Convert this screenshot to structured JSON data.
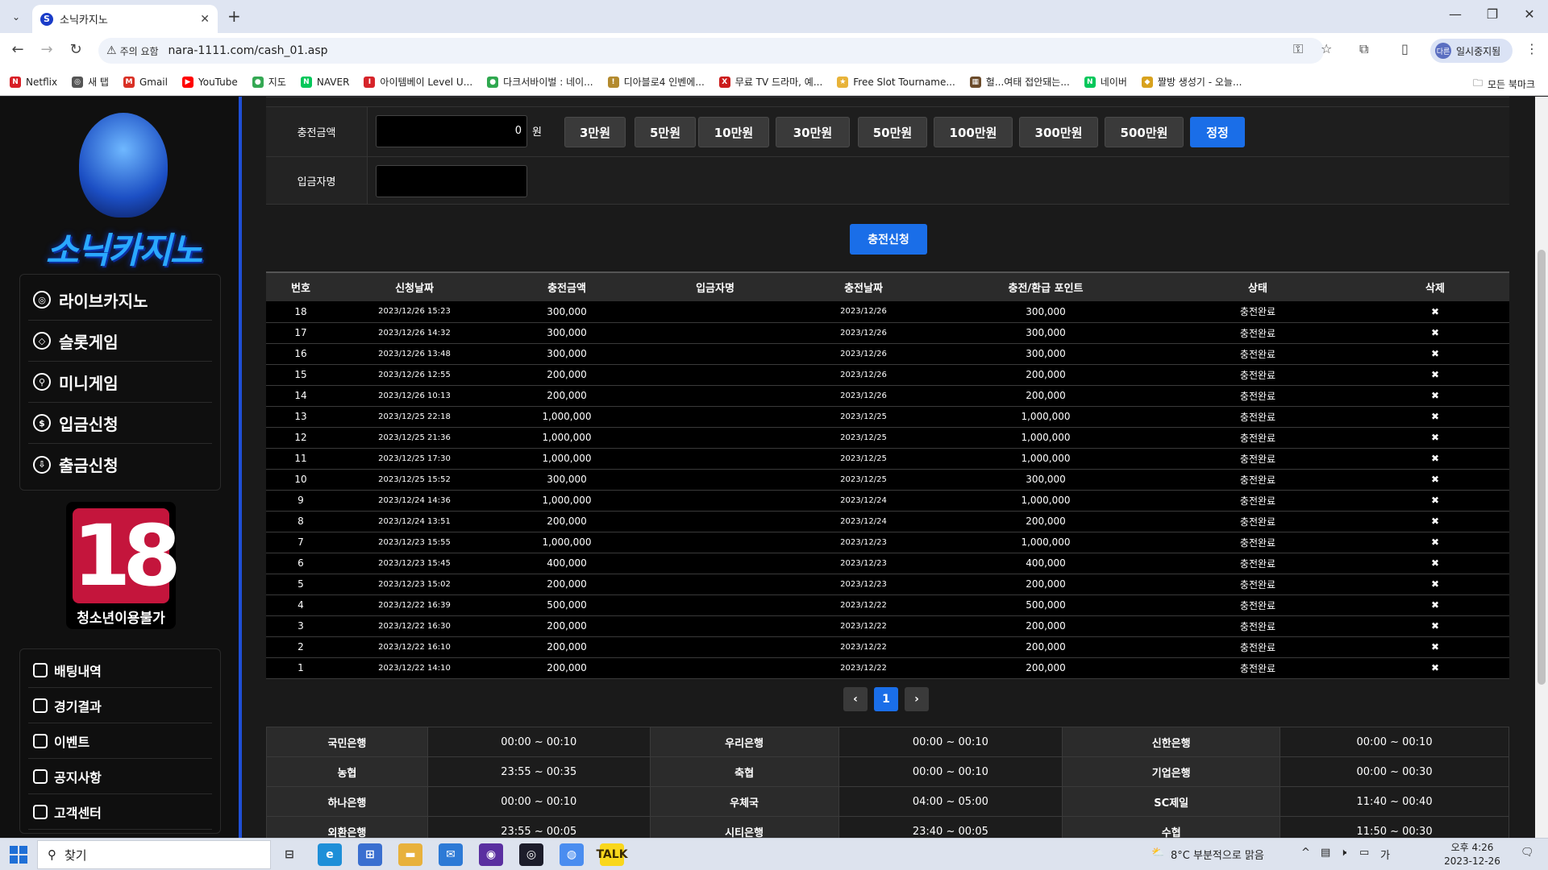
{
  "browser": {
    "tab_title": "소닉카지노",
    "tab_favicon": "S",
    "url": "nara-1111.com/cash_01.asp",
    "security_chip": "주의 요함",
    "profile_label": "일시중지됨",
    "profile_avatar": "다른"
  },
  "bookmarks": [
    {
      "label": "Netflix",
      "icon": "N",
      "color": "#d81f26"
    },
    {
      "label": "새 탭",
      "icon": "◎",
      "color": "#555555"
    },
    {
      "label": "Gmail",
      "icon": "M",
      "color": "#d93025"
    },
    {
      "label": "YouTube",
      "icon": "▶",
      "color": "#ff0000"
    },
    {
      "label": "지도",
      "icon": "●",
      "color": "#34a853"
    },
    {
      "label": "NAVER",
      "icon": "N",
      "color": "#03c75a"
    },
    {
      "label": "아이템베이 Level U...",
      "icon": "I",
      "color": "#d6242a"
    },
    {
      "label": "다크서바이벌 : 네이...",
      "icon": "●",
      "color": "#2fa84f"
    },
    {
      "label": "디아블로4 인벤에...",
      "icon": "!",
      "color": "#b38a2e"
    },
    {
      "label": "무료 TV 드라마, 예...",
      "icon": "X",
      "color": "#cc1c1c"
    },
    {
      "label": "Free Slot Tourname...",
      "icon": "★",
      "color": "#e8b339"
    },
    {
      "label": "헐...여태 접안돼는...",
      "icon": "▦",
      "color": "#6b4b2a"
    },
    {
      "label": "네이버",
      "icon": "N",
      "color": "#03c75a"
    },
    {
      "label": "짤방 생성기 - 오늘...",
      "icon": "◆",
      "color": "#d8a21e"
    }
  ],
  "bookmarks_all": "모든 북마크",
  "sidebar": {
    "brand": "소닉카지노",
    "main_menu": [
      {
        "label": "라이브카지노",
        "icon": "chip-icon"
      },
      {
        "label": "슬롯게임",
        "icon": "diamond-icon"
      },
      {
        "label": "미니게임",
        "icon": "joystick-icon"
      },
      {
        "label": "입금신청",
        "icon": "dollar-icon"
      },
      {
        "label": "출금신청",
        "icon": "download-icon"
      }
    ],
    "age_number": "18",
    "age_text": "청소년이용불가",
    "sub_menu": [
      {
        "label": "배팅내역",
        "icon": "list-icon"
      },
      {
        "label": "경기결과",
        "icon": "trophy-icon"
      },
      {
        "label": "이벤트",
        "icon": "gift-icon"
      },
      {
        "label": "공지사항",
        "icon": "megaphone-icon"
      },
      {
        "label": "고객센터",
        "icon": "headset-icon"
      }
    ]
  },
  "form": {
    "amount_label": "충전금액",
    "amount_value": "0",
    "amount_unit": "원",
    "amount_buttons": [
      "3만원",
      "5만원",
      "10만원",
      "30만원",
      "50만원",
      "100만원",
      "300만원",
      "500만원"
    ],
    "correct_button": "정정",
    "depositor_label": "입금자명",
    "submit_button": "충전신청"
  },
  "history": {
    "headers": [
      "번호",
      "신청날짜",
      "충전금액",
      "입금자명",
      "충전날짜",
      "충전/환급 포인트",
      "상태",
      "삭제"
    ],
    "rows": [
      [
        "18",
        "2023/12/26 15:23",
        "300,000",
        "",
        "2023/12/26",
        "300,000",
        "충전완료",
        "✖"
      ],
      [
        "17",
        "2023/12/26 14:32",
        "300,000",
        "",
        "2023/12/26",
        "300,000",
        "충전완료",
        "✖"
      ],
      [
        "16",
        "2023/12/26 13:48",
        "300,000",
        "",
        "2023/12/26",
        "300,000",
        "충전완료",
        "✖"
      ],
      [
        "15",
        "2023/12/26 12:55",
        "200,000",
        "",
        "2023/12/26",
        "200,000",
        "충전완료",
        "✖"
      ],
      [
        "14",
        "2023/12/26 10:13",
        "200,000",
        "",
        "2023/12/26",
        "200,000",
        "충전완료",
        "✖"
      ],
      [
        "13",
        "2023/12/25 22:18",
        "1,000,000",
        "",
        "2023/12/25",
        "1,000,000",
        "충전완료",
        "✖"
      ],
      [
        "12",
        "2023/12/25 21:36",
        "1,000,000",
        "",
        "2023/12/25",
        "1,000,000",
        "충전완료",
        "✖"
      ],
      [
        "11",
        "2023/12/25 17:30",
        "1,000,000",
        "",
        "2023/12/25",
        "1,000,000",
        "충전완료",
        "✖"
      ],
      [
        "10",
        "2023/12/25 15:52",
        "300,000",
        "",
        "2023/12/25",
        "300,000",
        "충전완료",
        "✖"
      ],
      [
        "9",
        "2023/12/24 14:36",
        "1,000,000",
        "",
        "2023/12/24",
        "1,000,000",
        "충전완료",
        "✖"
      ],
      [
        "8",
        "2023/12/24 13:51",
        "200,000",
        "",
        "2023/12/24",
        "200,000",
        "충전완료",
        "✖"
      ],
      [
        "7",
        "2023/12/23 15:55",
        "1,000,000",
        "",
        "2023/12/23",
        "1,000,000",
        "충전완료",
        "✖"
      ],
      [
        "6",
        "2023/12/23 15:45",
        "400,000",
        "",
        "2023/12/23",
        "400,000",
        "충전완료",
        "✖"
      ],
      [
        "5",
        "2023/12/23 15:02",
        "200,000",
        "",
        "2023/12/23",
        "200,000",
        "충전완료",
        "✖"
      ],
      [
        "4",
        "2023/12/22 16:39",
        "500,000",
        "",
        "2023/12/22",
        "500,000",
        "충전완료",
        "✖"
      ],
      [
        "3",
        "2023/12/22 16:30",
        "200,000",
        "",
        "2023/12/22",
        "200,000",
        "충전완료",
        "✖"
      ],
      [
        "2",
        "2023/12/22 16:10",
        "200,000",
        "",
        "2023/12/22",
        "200,000",
        "충전완료",
        "✖"
      ],
      [
        "1",
        "2023/12/22 14:10",
        "200,000",
        "",
        "2023/12/22",
        "200,000",
        "충전완료",
        "✖"
      ]
    ]
  },
  "pagination": {
    "prev": "‹",
    "current": "1",
    "next": "›"
  },
  "banks": [
    [
      {
        "name": "국민은행",
        "time": "00:00 ~ 00:10"
      },
      {
        "name": "우리은행",
        "time": "00:00 ~ 00:10"
      },
      {
        "name": "신한은행",
        "time": "00:00 ~ 00:10"
      }
    ],
    [
      {
        "name": "농협",
        "time": "23:55 ~ 00:35"
      },
      {
        "name": "축협",
        "time": "00:00 ~ 00:10"
      },
      {
        "name": "기업은행",
        "time": "00:00 ~ 00:30"
      }
    ],
    [
      {
        "name": "하나은행",
        "time": "00:00 ~ 00:10"
      },
      {
        "name": "우체국",
        "time": "04:00 ~ 05:00"
      },
      {
        "name": "SC제일",
        "time": "11:40 ~ 00:40"
      }
    ],
    [
      {
        "name": "외환은행",
        "time": "23:55 ~ 00:05"
      },
      {
        "name": "시티은행",
        "time": "23:40 ~ 00:05"
      },
      {
        "name": "수협",
        "time": "11:50 ~ 00:30"
      }
    ]
  ],
  "taskbar": {
    "search_placeholder": "찾기",
    "weather": "8°C  부분적으로 맑음",
    "time": "오후 4:26",
    "date": "2023-12-26"
  },
  "colors": {
    "accent_blue": "#1a6ee8",
    "age_red": "#c4153c"
  }
}
